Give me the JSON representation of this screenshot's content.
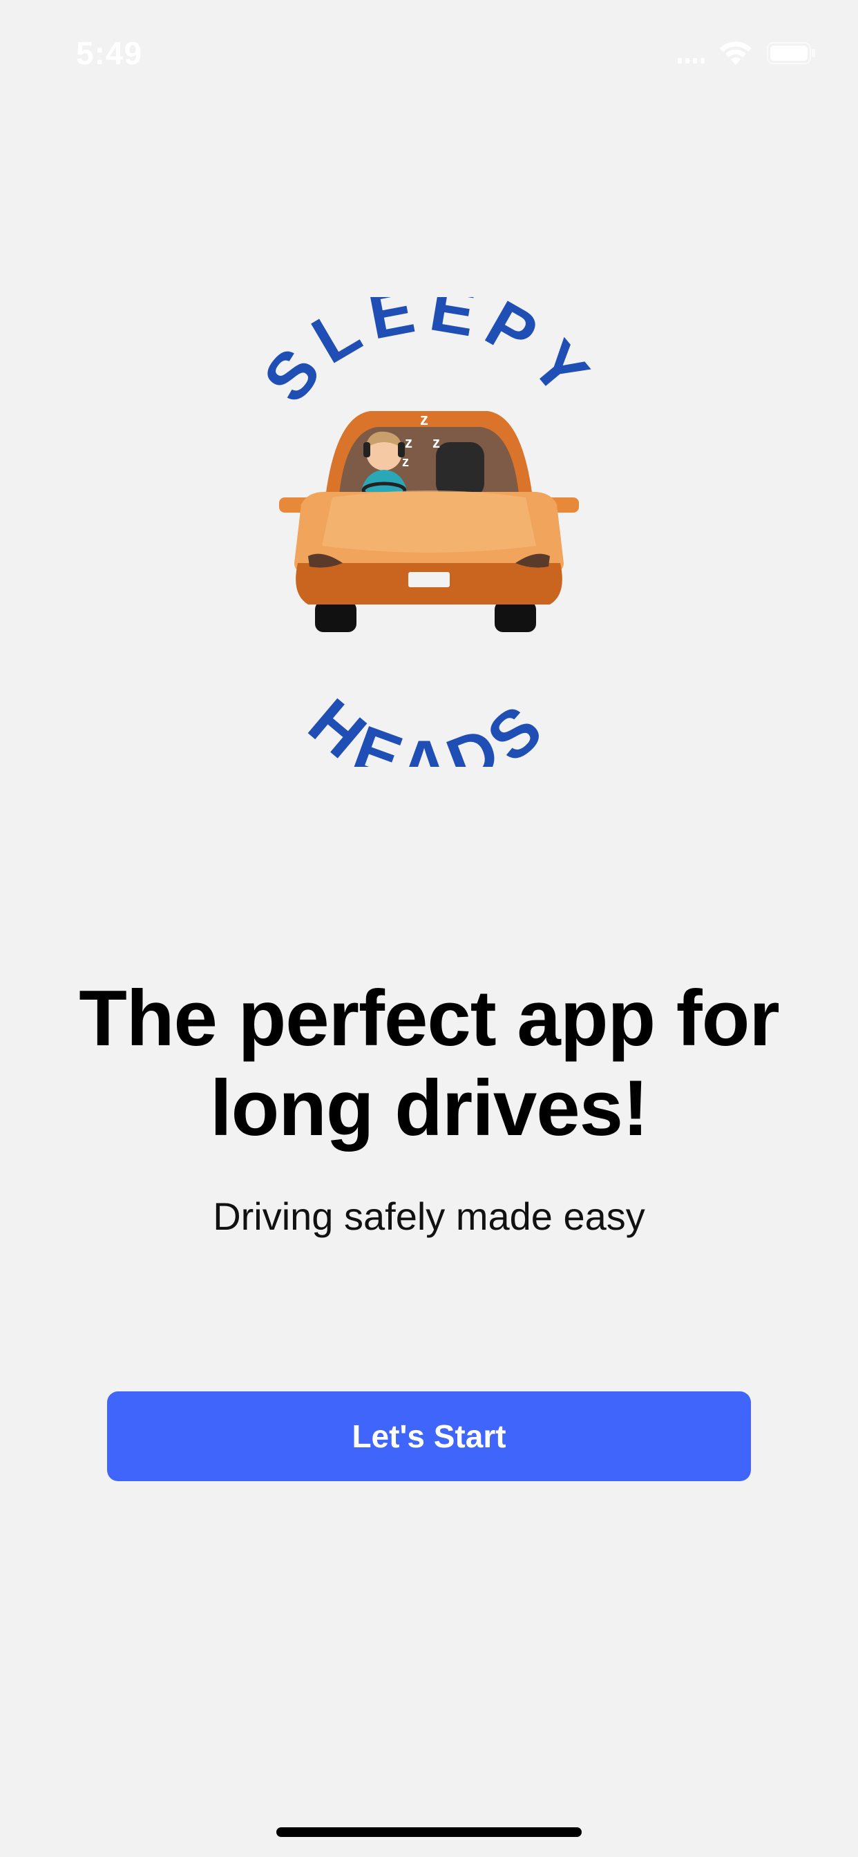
{
  "status_bar": {
    "time": "5:49",
    "icons": [
      "cellular-signal-icon",
      "wifi-icon",
      "battery-icon"
    ]
  },
  "logo": {
    "top_text": "SLEEPY",
    "bottom_text": "HEADS",
    "text_color": "#1f4fb5",
    "car_color": "#e8893a",
    "sleep_text": "z z z"
  },
  "hero": {
    "headline_line1": "The perfect app for",
    "headline_line2": "long drives!",
    "subtitle": "Driving safely made easy"
  },
  "actions": {
    "start_label": "Let's Start",
    "accent_color": "#4065fb"
  }
}
